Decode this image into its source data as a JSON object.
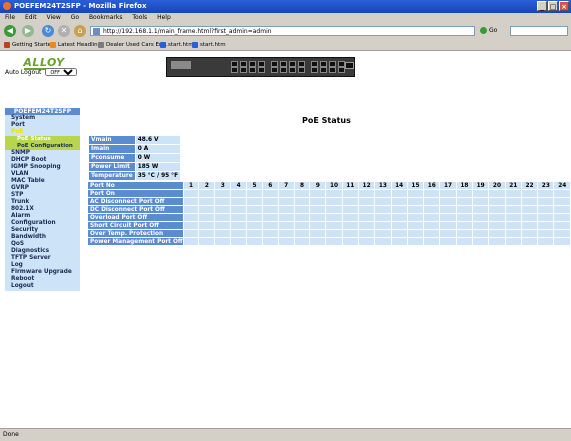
{
  "window": {
    "title": "POEFEM24T2SFP - Mozilla Firefox",
    "buttons": [
      "_",
      "□",
      "×"
    ]
  },
  "menu": [
    "File",
    "Edit",
    "View",
    "Go",
    "Bookmarks",
    "Tools",
    "Help"
  ],
  "nav": {
    "url": "http://192.168.1.1/main_frame.html?first_admin=admin",
    "go_label": "Go",
    "search_placeholder": ""
  },
  "bookmarks": [
    {
      "label": "Getting Started",
      "icon": "bookmark-icon"
    },
    {
      "label": "Latest Headlines",
      "icon": "rss-icon"
    },
    {
      "label": "Dealer Used Cars En...",
      "icon": "bookmark-icon"
    },
    {
      "label": "start.htm",
      "icon": "bookmark-icon"
    },
    {
      "label": "start.htm",
      "icon": "bookmark-icon"
    }
  ],
  "header": {
    "logo_text": "ALLOY",
    "auto_logout_label": "Auto Logout",
    "auto_logout_value": "OFF"
  },
  "sidebar": {
    "title": "POEFEM24T2SFP",
    "items": [
      {
        "label": "System",
        "active": false
      },
      {
        "label": "Port",
        "active": false
      },
      {
        "label": "PoE",
        "active": true
      },
      {
        "label": "PoE Status",
        "sub": true,
        "active": true
      },
      {
        "label": "PoE Configuration",
        "sub": true,
        "active": false
      },
      {
        "label": "SNMP"
      },
      {
        "label": "DHCP Boot"
      },
      {
        "label": "IGMP Snooping"
      },
      {
        "label": "VLAN"
      },
      {
        "label": "MAC Table"
      },
      {
        "label": "GVRP"
      },
      {
        "label": "STP"
      },
      {
        "label": "Trunk"
      },
      {
        "label": "802.1X"
      },
      {
        "label": "Alarm"
      },
      {
        "label": "Configuration"
      },
      {
        "label": "Security"
      },
      {
        "label": "Bandwidth"
      },
      {
        "label": "QoS"
      },
      {
        "label": "Diagnostics"
      },
      {
        "label": "TFTP Server"
      },
      {
        "label": "Log"
      },
      {
        "label": "Firmware Upgrade"
      },
      {
        "label": "Reboot"
      },
      {
        "label": "Logout"
      }
    ]
  },
  "main": {
    "title": "PoE Status",
    "info": [
      {
        "label": "Vmain",
        "value": "48.6 V"
      },
      {
        "label": "Imain",
        "value": "0 A"
      },
      {
        "label": "Pconsume",
        "value": "0 W"
      },
      {
        "label": "Power Limit",
        "value": "185 W"
      },
      {
        "label": "Temperature",
        "value": "35 °C / 95 °F"
      }
    ],
    "port_header": "Port No",
    "ports": [
      "1",
      "2",
      "3",
      "4",
      "5",
      "6",
      "7",
      "8",
      "9",
      "10",
      "11",
      "12",
      "13",
      "14",
      "15",
      "16",
      "17",
      "18",
      "19",
      "20",
      "21",
      "22",
      "23",
      "24"
    ],
    "rows": [
      "Port On",
      "AC Disconnect Port Off",
      "DC Disconnect Port Off",
      "Overload Port Off",
      "Short Circuit Port Off",
      "Over Temp. Protection",
      "Power Management Port Off"
    ]
  },
  "statusbar": {
    "text": "Done"
  }
}
